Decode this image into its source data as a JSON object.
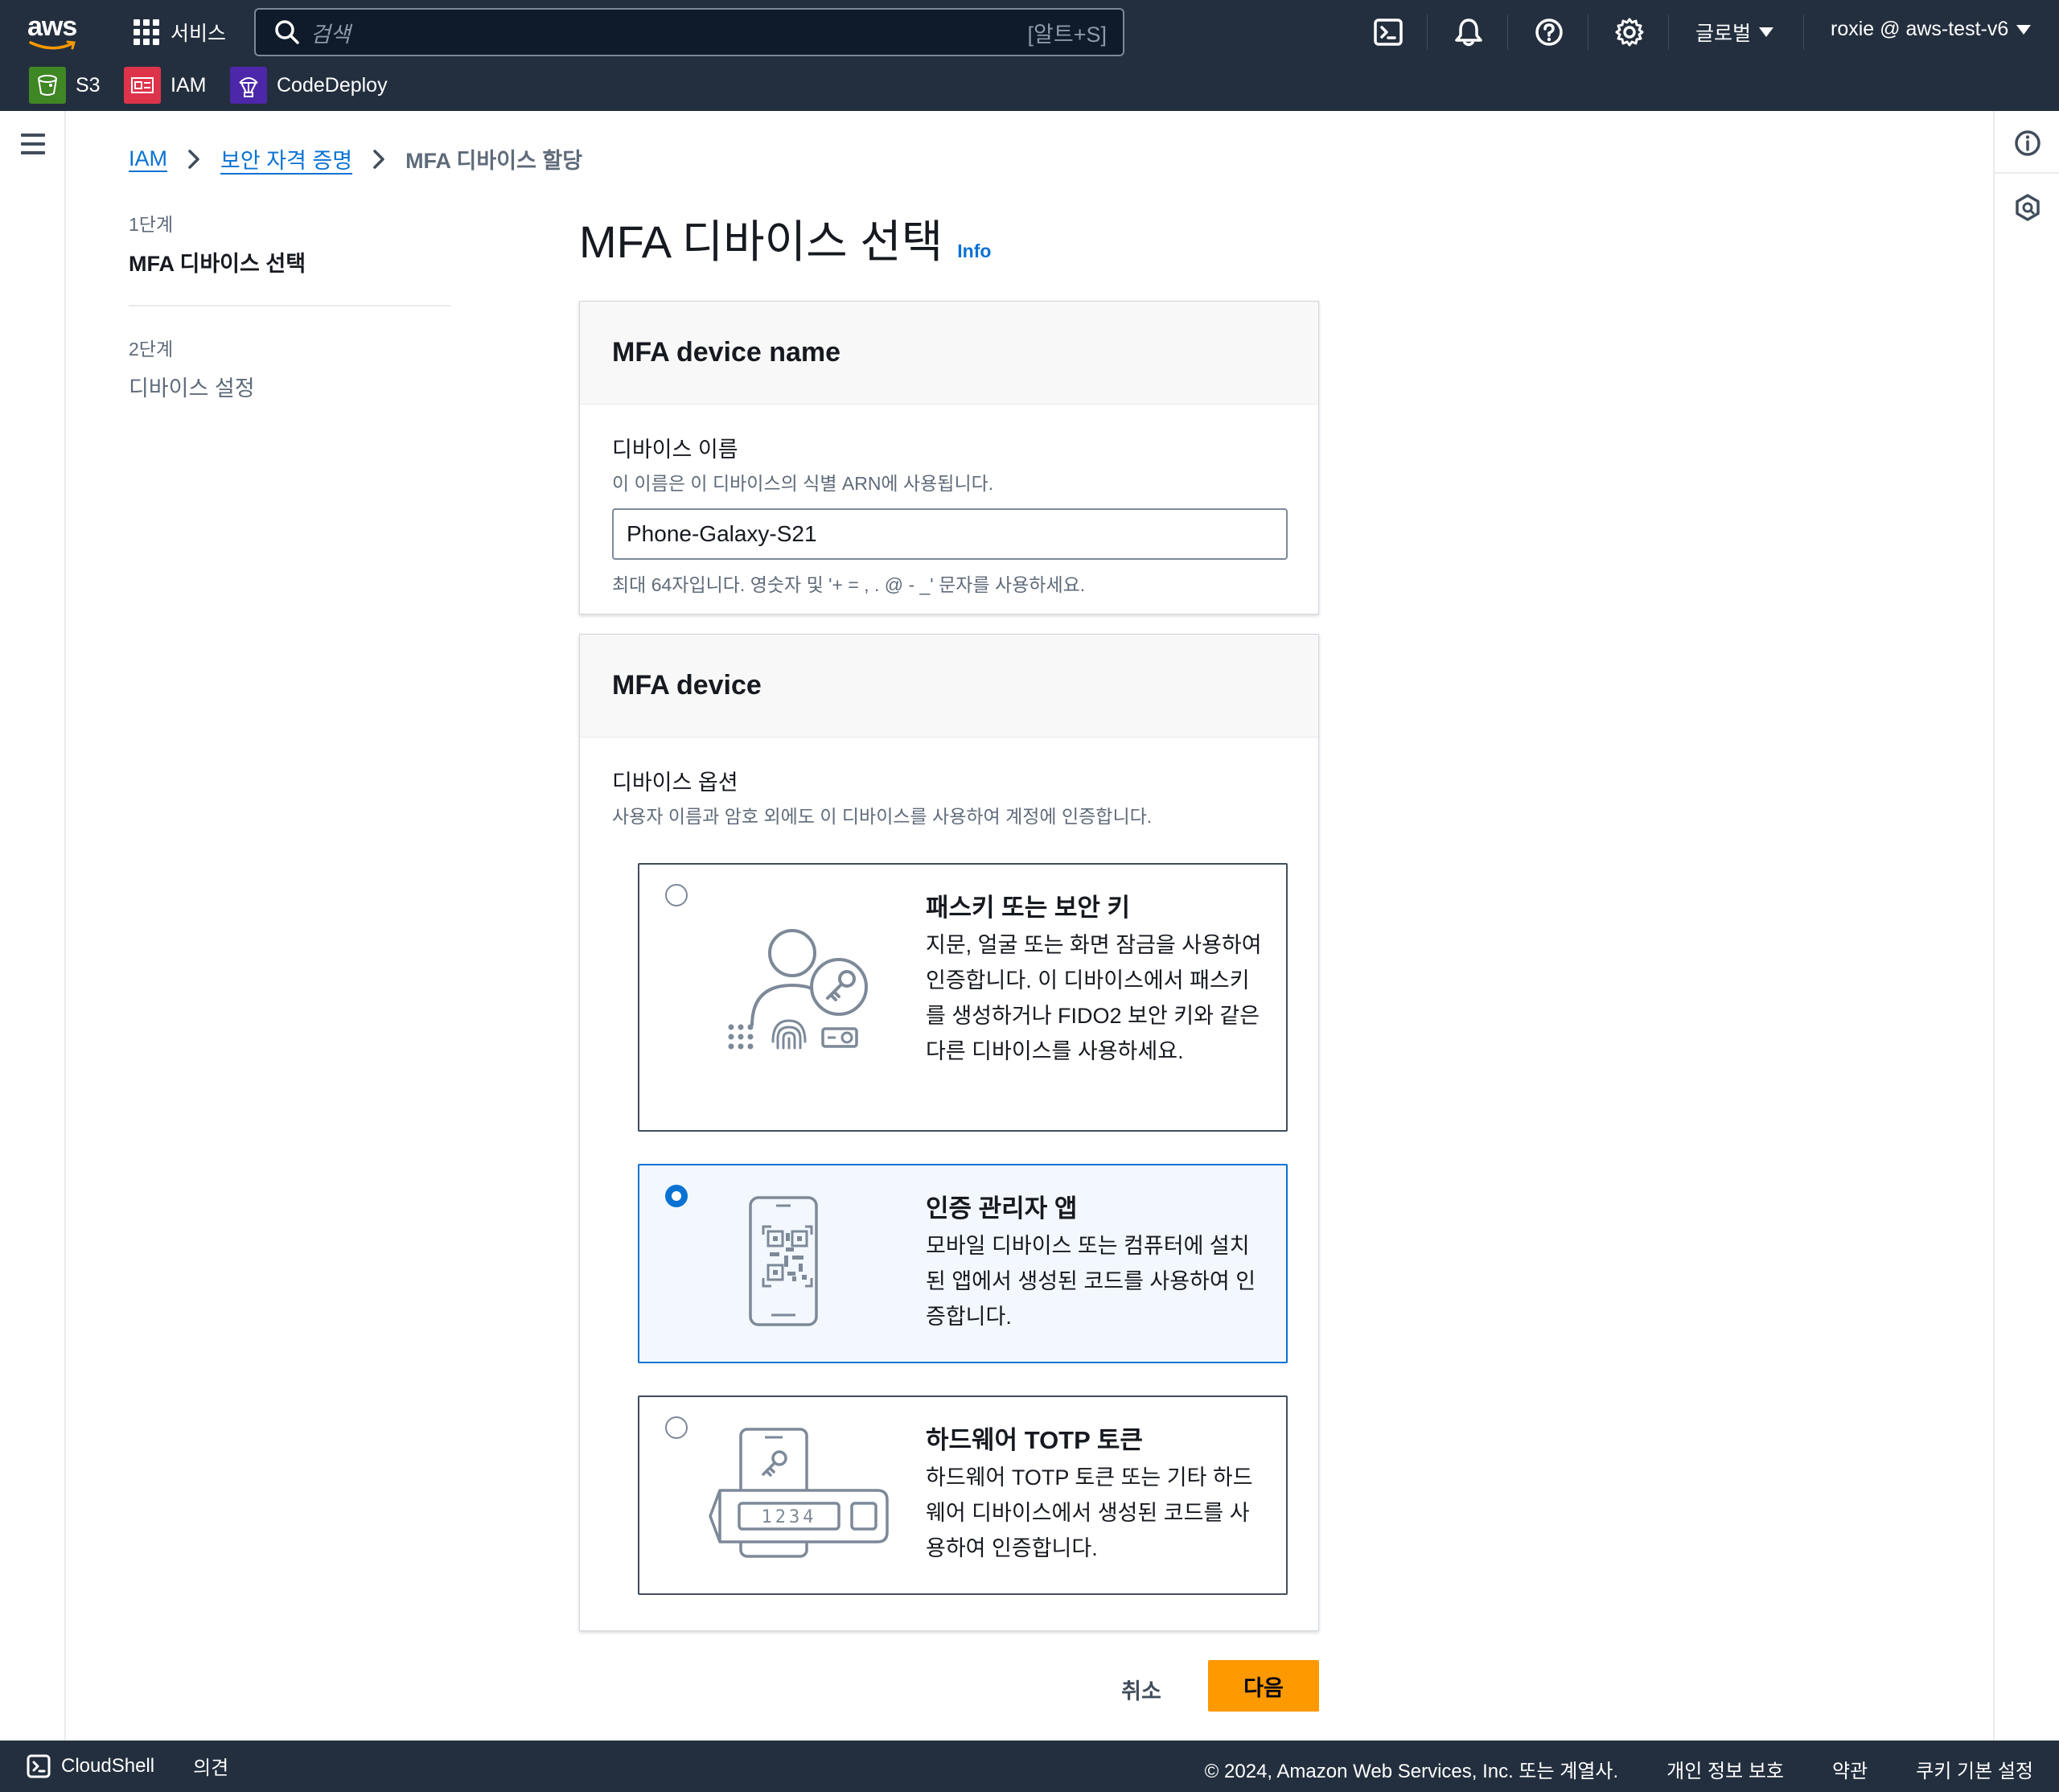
{
  "topnav": {
    "logo_text": "aws",
    "services_label": "서비스",
    "search_placeholder": "검색",
    "search_shortcut": "[알트+S]",
    "region_label": "글로벌",
    "account_label": "roxie @ aws-test-v6",
    "favorites": [
      {
        "label": "S3",
        "color": "#3f8624"
      },
      {
        "label": "IAM",
        "color": "#dd344c"
      },
      {
        "label": "CodeDeploy",
        "color": "#4d27aa"
      }
    ]
  },
  "breadcrumb": {
    "items": [
      "IAM",
      "보안 자격 증명"
    ],
    "current": "MFA 디바이스 할당"
  },
  "steps": [
    {
      "number": "1단계",
      "title": "MFA 디바이스 선택",
      "active": true
    },
    {
      "number": "2단계",
      "title": "디바이스 설정",
      "active": false
    }
  ],
  "page": {
    "title": "MFA 디바이스 선택",
    "info": "Info"
  },
  "device_name_section": {
    "header": "MFA device name",
    "label": "디바이스 이름",
    "description": "이 이름은 이 디바이스의 식별 ARN에 사용됩니다.",
    "value": "Phone-Galaxy-S21",
    "constraint": "최대 64자입니다. 영숫자 및 '+ = , . @ - _' 문자를 사용하세요."
  },
  "device_section": {
    "header": "MFA device",
    "label": "디바이스 옵션",
    "description": "사용자 이름과 암호 외에도 이 디바이스를 사용하여 계정에 인증합니다.",
    "options": [
      {
        "title": "패스키 또는 보안 키",
        "description": "지문, 얼굴 또는 화면 잠금을 사용하여 인증합니다. 이 디바이스에서 패스키를 생성하거나 FIDO2 보안 키와 같은 다른 디바이스를 사용하세요.",
        "selected": false
      },
      {
        "title": "인증 관리자 앱",
        "description": "모바일 디바이스 또는 컴퓨터에 설치된 앱에서 생성된 코드를 사용하여 인증합니다.",
        "selected": true
      },
      {
        "title": "하드웨어 TOTP 토큰",
        "description": "하드웨어 TOTP 토큰 또는 기타 하드웨어 디바이스에서 생성된 코드를 사용하여 인증합니다.",
        "selected": false,
        "token_display": "1234"
      }
    ]
  },
  "actions": {
    "cancel": "취소",
    "next": "다음"
  },
  "footer": {
    "cloudshell": "CloudShell",
    "feedback": "의견",
    "copyright": "© 2024, Amazon Web Services, Inc. 또는 계열사.",
    "privacy": "개인 정보 보호",
    "terms": "약관",
    "cookies": "쿠키 기본 설정"
  },
  "colors": {
    "nav_bg": "#232f3e",
    "link": "#0972d3",
    "primary_button": "#ff9900",
    "selected_tile_bg": "#f2f8fd"
  }
}
